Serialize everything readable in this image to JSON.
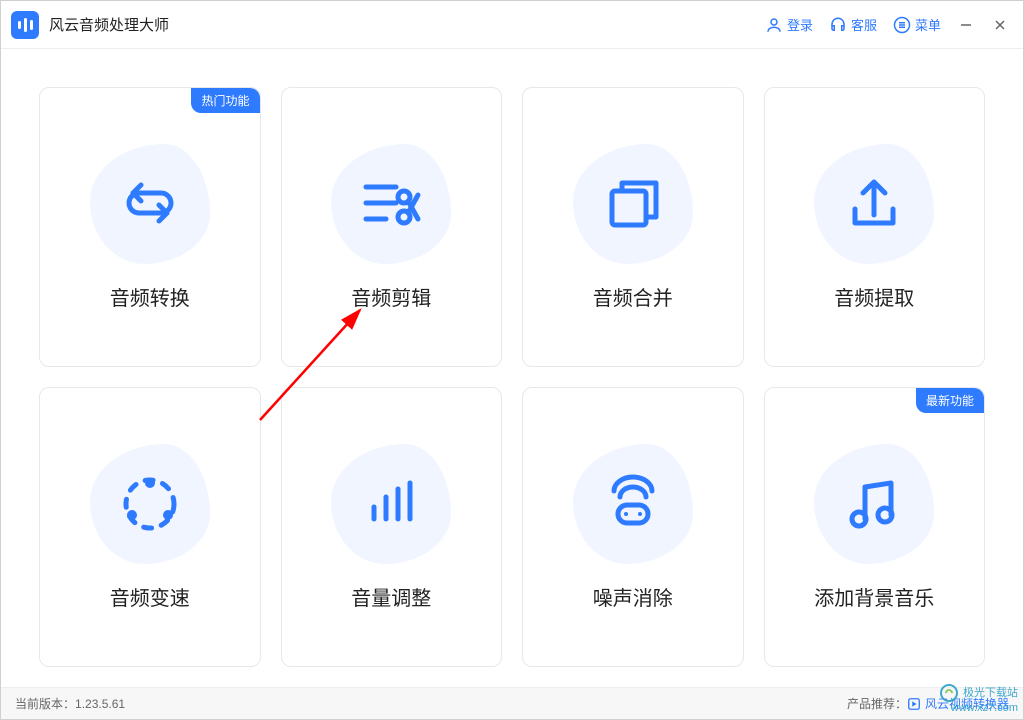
{
  "app": {
    "title": "风云音频处理大师"
  },
  "titlebar": {
    "login": "登录",
    "support": "客服",
    "menu": "菜单"
  },
  "badges": {
    "hot": "热门功能",
    "new": "最新功能"
  },
  "cards": [
    {
      "label": "音频转换",
      "badge": "hot"
    },
    {
      "label": "音频剪辑"
    },
    {
      "label": "音频合并"
    },
    {
      "label": "音频提取"
    },
    {
      "label": "音频变速"
    },
    {
      "label": "音量调整"
    },
    {
      "label": "噪声消除"
    },
    {
      "label": "添加背景音乐",
      "badge": "new"
    }
  ],
  "footer": {
    "version_label": "当前版本：",
    "version": "1.23.5.61",
    "recommend_label": "产品推荐：",
    "recommend_product": "风云视频转换器"
  },
  "colors": {
    "accent": "#2f7bff"
  },
  "watermark": {
    "line1": "极光下载站",
    "line2": "www.xz7.com"
  }
}
